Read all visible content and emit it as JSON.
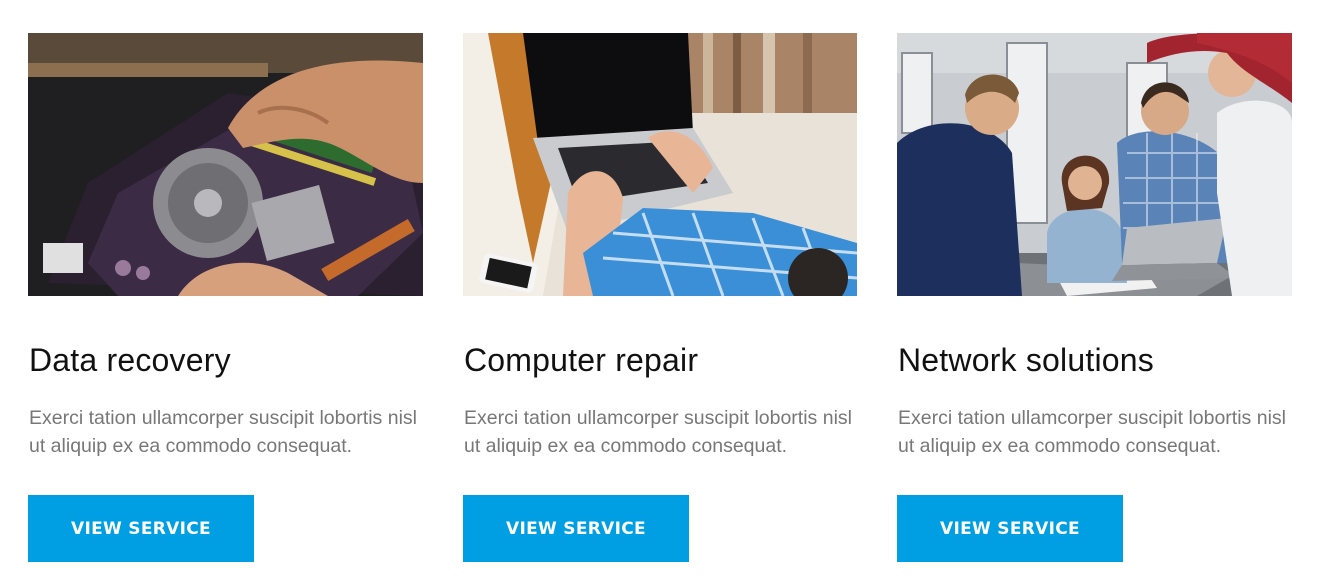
{
  "colors": {
    "button_bg": "#009fe3",
    "button_text": "#ffffff",
    "title_text": "#111111",
    "description_text": "#777777"
  },
  "services": [
    {
      "image": "hands-repairing-motherboard-photo",
      "title": "Data recovery",
      "description": "Exerci tation ullamcorper suscipit lobortis nisl ut aliquip ex ea commodo consequat.",
      "button_label": "VIEW SERVICE"
    },
    {
      "image": "person-with-laptop-on-sofa-photo",
      "title": "Computer repair",
      "description": "Exerci tation ullamcorper suscipit lobortis nisl ut aliquip ex ea commodo consequat.",
      "button_label": "VIEW SERVICE"
    },
    {
      "image": "team-around-laptop-photo",
      "title": "Network solutions",
      "description": "Exerci tation ullamcorper suscipit lobortis nisl ut aliquip ex ea commodo consequat.",
      "button_label": "VIEW SERVICE"
    }
  ]
}
